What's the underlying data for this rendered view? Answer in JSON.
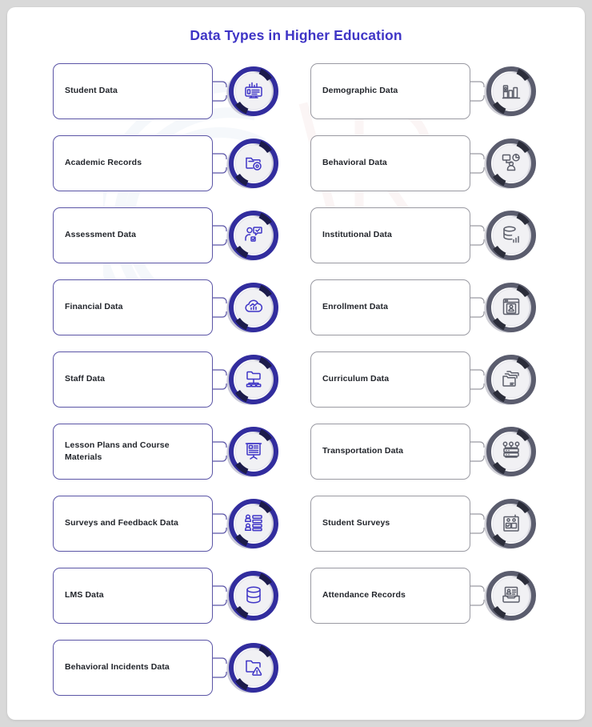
{
  "title": "Data Types in Higher Education",
  "colors": {
    "title": "#3f35c6",
    "left_ring": "#322d9e",
    "left_ring_dark": "#1c1b4b",
    "left_border": "#5b55a6",
    "left_icon": "#3f35c6",
    "right_ring": "#5b5d6e",
    "right_ring_dark": "#2b2d3a",
    "right_border": "#9a9aa2",
    "right_icon": "#5c5f6b",
    "page_bg": "#d9d9d9",
    "card_bg": "#ffffff"
  },
  "columns": {
    "left": [
      {
        "label": "Student Data",
        "icon": "monitor-chart-id-icon"
      },
      {
        "label": "Academic Records",
        "icon": "folder-record-icon"
      },
      {
        "label": "Assessment Data",
        "icon": "person-checkmark-chat-icon"
      },
      {
        "label": "Financial Data",
        "icon": "cloud-chart-icon"
      },
      {
        "label": "Staff Data",
        "icon": "folder-org-chart-icon"
      },
      {
        "label": "Lesson Plans and Course Materials",
        "icon": "presentation-board-icon"
      },
      {
        "label": "Surveys and Feedback Data",
        "icon": "people-list-icon"
      },
      {
        "label": "LMS Data",
        "icon": "database-icon"
      },
      {
        "label": "Behavioral Incidents Data",
        "icon": "folder-alert-icon"
      }
    ],
    "right": [
      {
        "label": "Demographic Data",
        "icon": "bar-chart-person-icon"
      },
      {
        "label": "Behavioral Data",
        "icon": "person-screen-pie-icon"
      },
      {
        "label": "Institutional Data",
        "icon": "database-bars-icon"
      },
      {
        "label": "Enrollment Data",
        "icon": "browser-form-icon"
      },
      {
        "label": "Curriculum Data",
        "icon": "folders-stack-icon"
      },
      {
        "label": "Transportation Data",
        "icon": "network-server-icon"
      },
      {
        "label": "Student Surveys",
        "icon": "clipboard-checklist-icon"
      },
      {
        "label": "Attendance Records",
        "icon": "card-tray-icon"
      }
    ]
  }
}
